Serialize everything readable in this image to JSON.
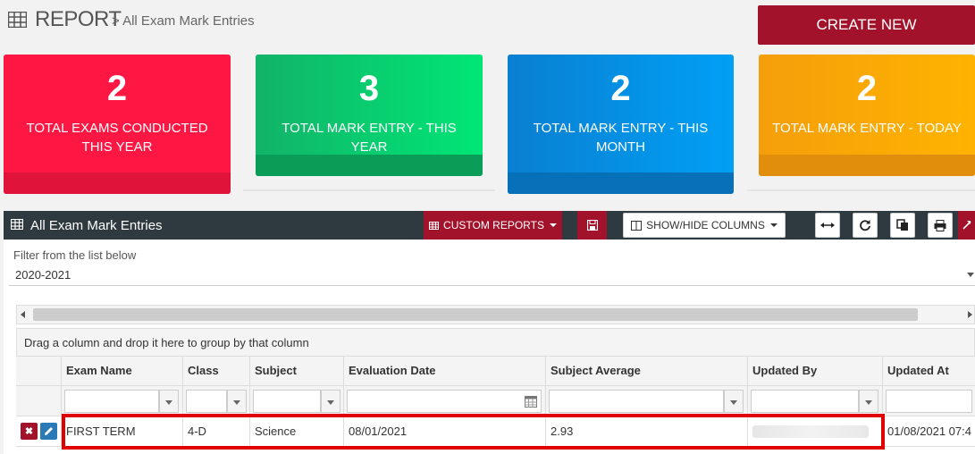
{
  "header": {
    "title": "REPORT",
    "breadcrumb": "> All Exam Mark Entries",
    "create_label": "CREATE NEW"
  },
  "cards": [
    {
      "value": "2",
      "label": "TOTAL EXAMS CONDUCTED THIS YEAR",
      "color": "#ff1744"
    },
    {
      "value": "3",
      "label": "TOTAL MARK ENTRY - THIS YEAR",
      "color": "#00c864"
    },
    {
      "value": "2",
      "label": "TOTAL MARK ENTRY - THIS MONTH",
      "color": "#0a8ee0"
    },
    {
      "value": "2",
      "label": "TOTAL MARK ENTRY - TODAY",
      "color": "#ffa000"
    }
  ],
  "panel": {
    "title": "All Exam Mark Entries",
    "custom_reports_label": "CUSTOM REPORTS",
    "show_hide_label": "SHOW/HIDE COLUMNS"
  },
  "filter": {
    "label": "Filter from the list below",
    "value": "2020-2021"
  },
  "grid": {
    "group_hint": "Drag a column and drop it here to group by that column",
    "columns": [
      "Exam Name",
      "Class",
      "Subject",
      "Evaluation Date",
      "Subject Average",
      "Updated By",
      "Updated At"
    ],
    "rows": [
      {
        "exam_name": "FIRST TERM",
        "class": "4-D",
        "subject": "Science",
        "evaluation_date": "08/01/2021",
        "subject_average": "2.93",
        "updated_by": "",
        "updated_at": "01/08/2021 07:4"
      }
    ]
  },
  "colors": {
    "brand_red": "#a3122b",
    "panel_dark": "#2e3940",
    "highlight": "#e00000"
  }
}
